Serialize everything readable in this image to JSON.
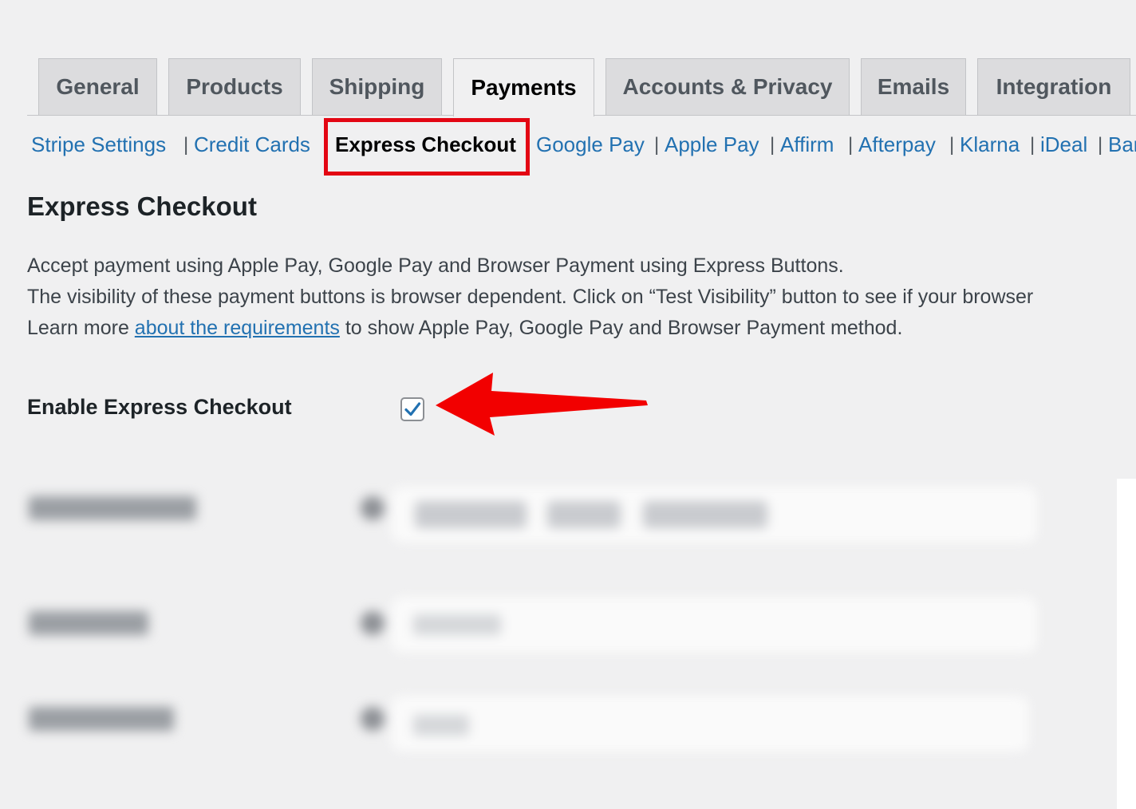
{
  "tabs": [
    {
      "label": "General",
      "active": false
    },
    {
      "label": "Products",
      "active": false
    },
    {
      "label": "Shipping",
      "active": false
    },
    {
      "label": "Payments",
      "active": true
    },
    {
      "label": "Accounts & Privacy",
      "active": false
    },
    {
      "label": "Emails",
      "active": false
    },
    {
      "label": "Integration",
      "active": false
    }
  ],
  "subnav": {
    "separator": "|",
    "links": [
      "Stripe Settings",
      "Credit Cards",
      "Express Checkout",
      "Google Pay",
      "Apple Pay",
      "Affirm",
      "Afterpay",
      "Klarna",
      "iDeal",
      "Ban"
    ],
    "current": "Express Checkout"
  },
  "section": {
    "title": "Express Checkout",
    "line1": "Accept payment using Apple Pay, Google Pay and Browser Payment using Express Buttons.",
    "line2": "The visibility of these payment buttons is browser dependent. Click on “Test Visibility” button to see if your browser",
    "line3_before": "Learn more ",
    "line3_link": "about the requirements",
    "line3_after": " to show Apple Pay, Google Pay and Browser Payment method."
  },
  "enable_field": {
    "label": "Enable Express Checkout",
    "checked": true
  },
  "colors": {
    "accent": "#2271b1",
    "highlight": "#e30613",
    "arrow": "#f20000"
  }
}
